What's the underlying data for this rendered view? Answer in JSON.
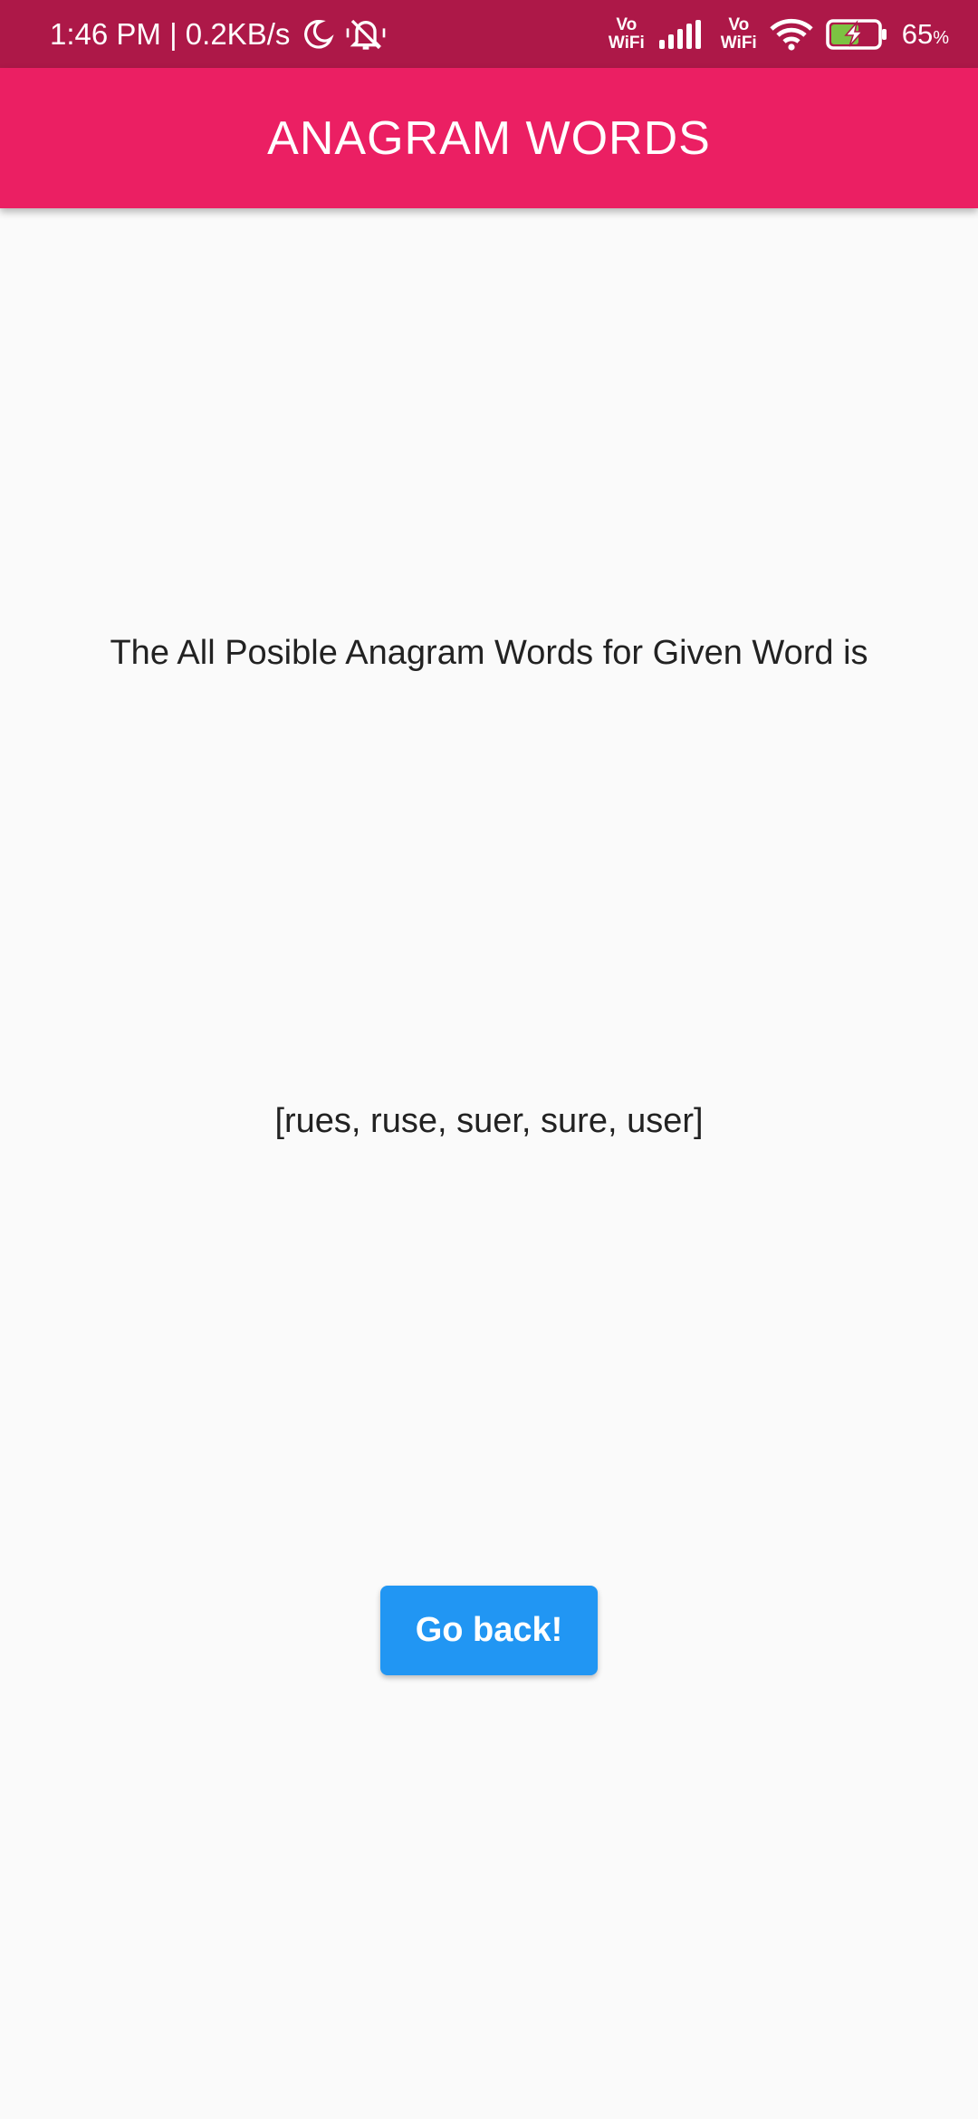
{
  "status_bar": {
    "time_speed": "1:46 PM | 0.2KB/s",
    "vowifi_1": [
      "Vo",
      "WiFi"
    ],
    "vowifi_2": [
      "Vo",
      "WiFi"
    ],
    "battery_percent": "65",
    "battery_unit": "%",
    "icons": [
      "moon-icon",
      "bell-muted-icon",
      "signal-icon",
      "wifi-icon",
      "battery-charging-icon"
    ]
  },
  "app_bar": {
    "title": "ANAGRAM WORDS",
    "color": "#eb1f63"
  },
  "main": {
    "heading": "The All Posible Anagram Words for Given Word is",
    "result": "[rues, ruse, suer, sure, user]",
    "go_back_label": "Go back!",
    "button_color": "#2196f3"
  }
}
